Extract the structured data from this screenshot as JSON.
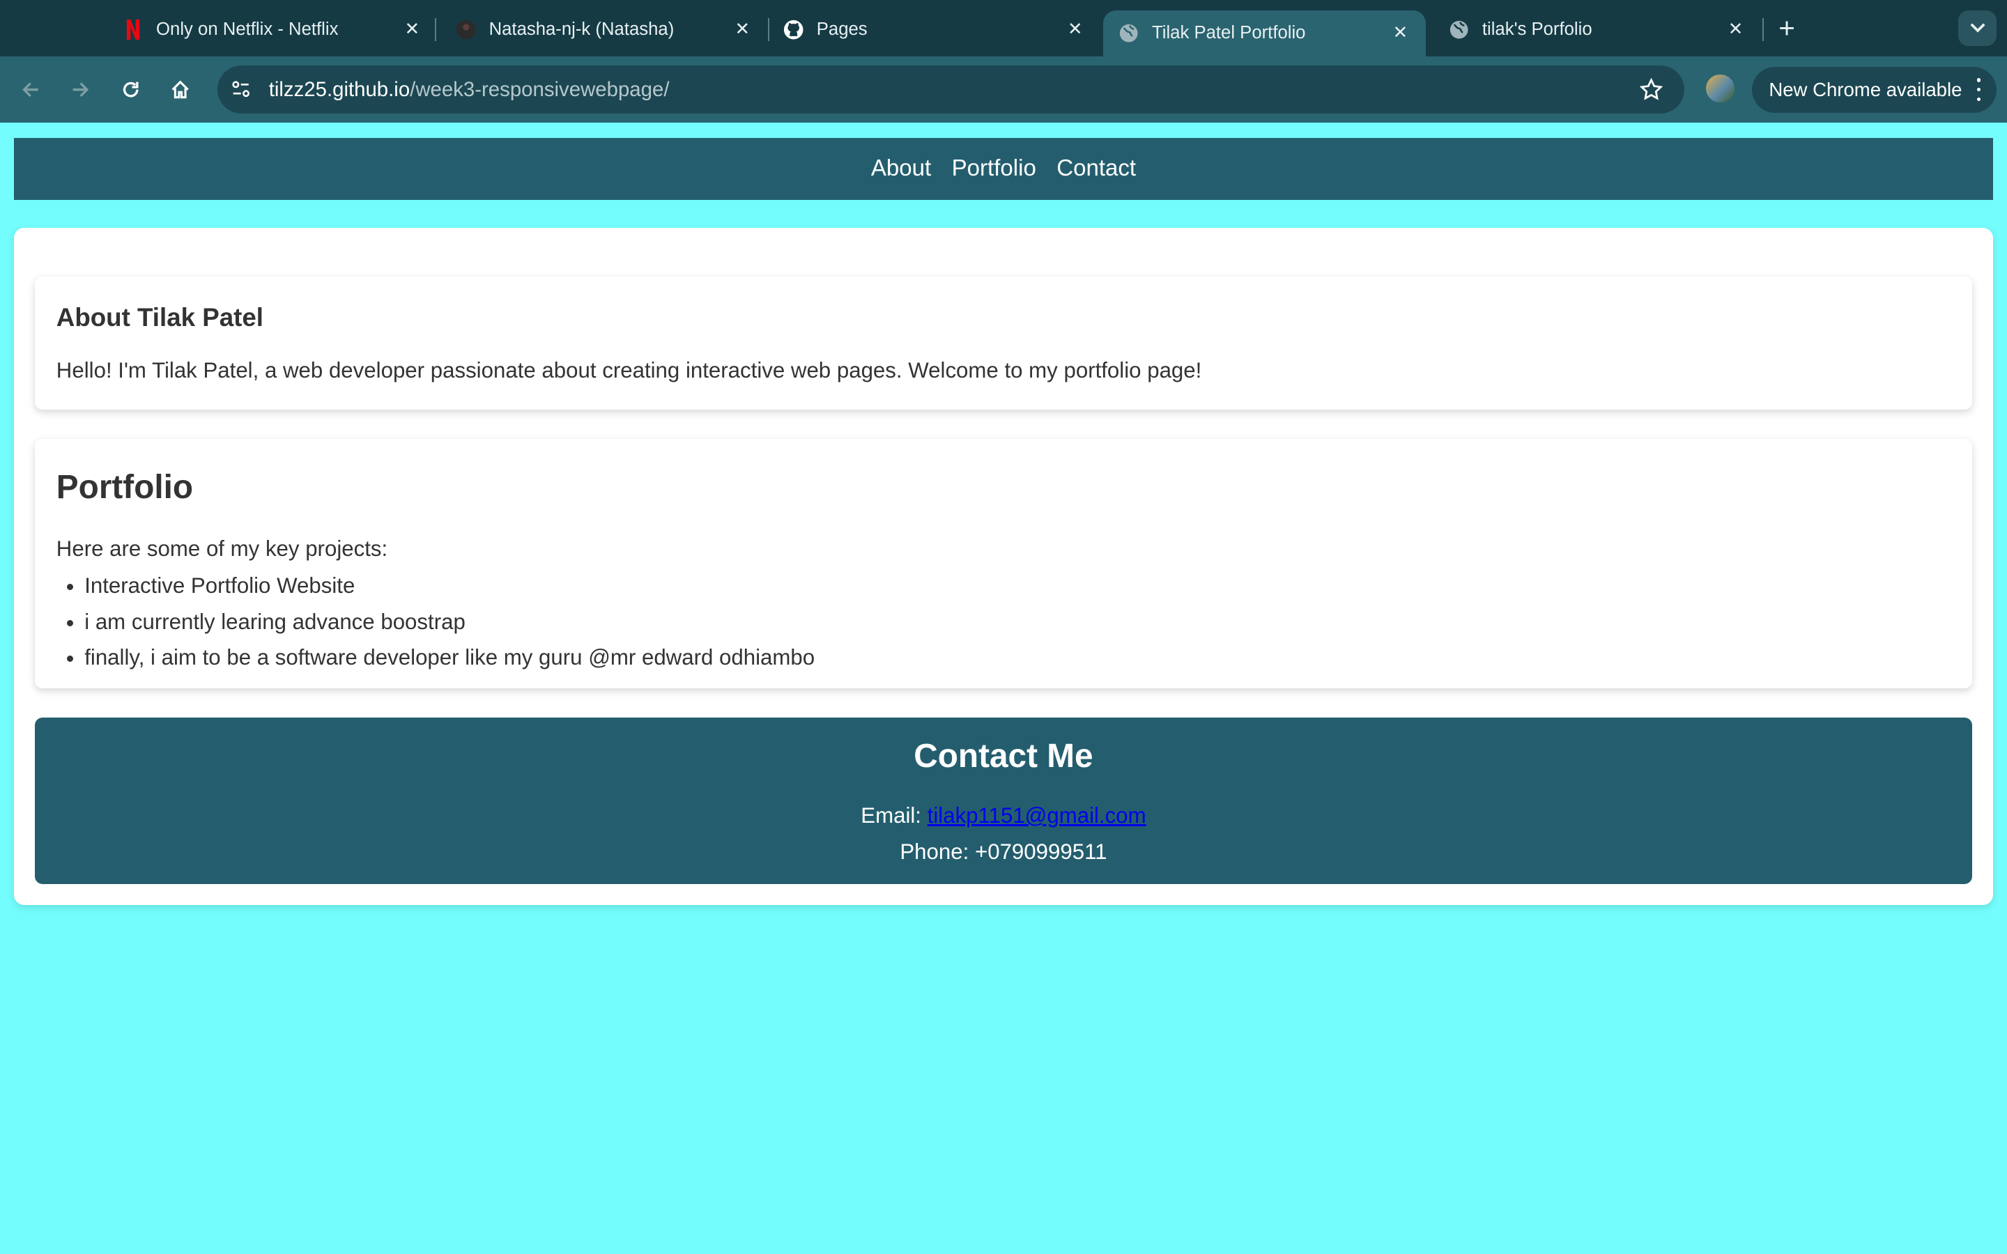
{
  "browser": {
    "tabs": [
      {
        "title": "Only on Netflix - Netflix",
        "icon": "netflix-icon"
      },
      {
        "title": "Natasha-nj-k (Natasha)",
        "icon": "github-avatar-icon"
      },
      {
        "title": "Pages",
        "icon": "github-icon"
      },
      {
        "title": "Tilak Patel Portfolio",
        "icon": "globe-icon",
        "active": true
      },
      {
        "title": "tilak's Porfolio",
        "icon": "globe-icon"
      }
    ],
    "url_host": "tilzz25.github.io",
    "url_path": "/week3-responsivewebpage/",
    "update_chip": "New Chrome available"
  },
  "nav": {
    "links": [
      "About",
      "Portfolio",
      "Contact"
    ]
  },
  "about": {
    "heading": "About Tilak Patel",
    "text": "Hello! I'm Tilak Patel, a web developer passionate about creating interactive web pages. Welcome to my portfolio page!"
  },
  "portfolio": {
    "heading": "Portfolio",
    "intro": "Here are some of my key projects:",
    "items": [
      "Interactive Portfolio Website",
      "i am currently learing advance boostrap",
      "finally, i aim to be a software developer like my guru @mr edward odhiambo"
    ]
  },
  "contact": {
    "heading": "Contact Me",
    "email_label": "Email: ",
    "email": "tilakp1151@gmail.com",
    "phone": "Phone: +0790999511"
  },
  "colors": {
    "page_background": "#74fdfd",
    "header_background": "#245e6e",
    "tabbar": "#153a44",
    "toolbar": "#2a6470"
  }
}
